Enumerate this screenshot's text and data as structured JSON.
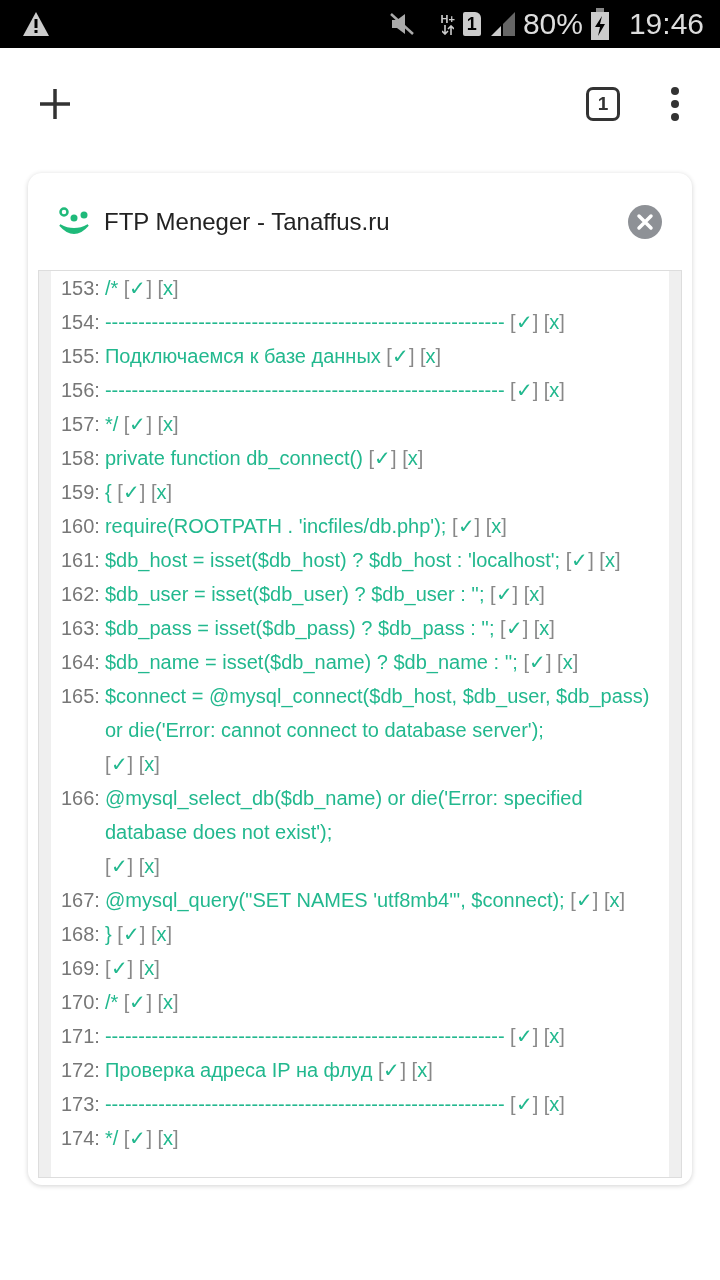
{
  "status_bar": {
    "network_type": "H+",
    "sim_slot": "1",
    "battery": "80%",
    "time": "19:46"
  },
  "toolbar": {
    "tab_count": "1"
  },
  "card": {
    "title": "FTP Meneger - Tanaffus.ru"
  },
  "lines": [
    {
      "number": "153:",
      "code": "/*",
      "accept": "[✓]",
      "reject": "[x]"
    },
    {
      "number": "154:",
      "code": "------------------------------------------------------------",
      "accept": "[✓]",
      "reject": "[x]"
    },
    {
      "number": "155:",
      "code": "Подключаемся к базе данных",
      "accept": "[✓]",
      "reject": "[x]"
    },
    {
      "number": "156:",
      "code": "------------------------------------------------------------",
      "accept": "[✓]",
      "reject": "[x]"
    },
    {
      "number": "157:",
      "code": "*/",
      "accept": "[✓]",
      "reject": "[x]"
    },
    {
      "number": "158:",
      "code": "private function db_connect()",
      "accept": "[✓]",
      "reject": "[x]"
    },
    {
      "number": "159:",
      "code": "{",
      "accept": "[✓]",
      "reject": "[x]"
    },
    {
      "number": "160:",
      "code": "require(ROOTPATH . 'incfiles/db.php');",
      "accept": "[✓]",
      "reject": "[x]"
    },
    {
      "number": "161:",
      "code": "$db_host = isset($db_host) ? $db_host : 'localhost';",
      "accept": "[✓]",
      "reject": "[x]"
    },
    {
      "number": "162:",
      "code": "$db_user = isset($db_user) ? $db_user : '';",
      "accept": "[✓]",
      "reject": "[x]"
    },
    {
      "number": "163:",
      "code": "$db_pass = isset($db_pass) ? $db_pass : '';",
      "accept": "[✓]",
      "reject": "[x]"
    },
    {
      "number": "164:",
      "code": "$db_name = isset($db_name) ? $db_name : '';",
      "accept": "[✓]",
      "reject": "[x]"
    },
    {
      "number": "165:",
      "code": "$connect = @mysql_connect($db_host, $db_user, $db_pass) or die('Error: cannot connect to database server');",
      "accept": "[✓]",
      "reject": "[x]"
    },
    {
      "number": "166:",
      "code": "@mysql_select_db($db_name) or die('Error: specified database does not exist');",
      "accept": "[✓]",
      "reject": "[x]"
    },
    {
      "number": "167:",
      "code": "@mysql_query(\"SET NAMES 'utf8mb4'\", $connect);",
      "accept": "[✓]",
      "reject": "[x]"
    },
    {
      "number": "168:",
      "code": "}",
      "accept": "[✓]",
      "reject": "[x]"
    },
    {
      "number": "169:",
      "accept": "[✓]",
      "reject": "[x]"
    },
    {
      "number": "170:",
      "code": "/*",
      "accept": "[✓]",
      "reject": "[x]"
    },
    {
      "number": "171:",
      "code": "------------------------------------------------------------",
      "accept": "[✓]",
      "reject": "[x]"
    },
    {
      "number": "172:",
      "code": "Проверка адреса IP на флуд",
      "accept": "[✓]",
      "reject": "[x]"
    },
    {
      "number": "173:",
      "code": "------------------------------------------------------------",
      "accept": "[✓]",
      "reject": "[x]"
    },
    {
      "number": "174:",
      "code": "*/",
      "accept": "[✓]",
      "reject": "[x]"
    }
  ]
}
